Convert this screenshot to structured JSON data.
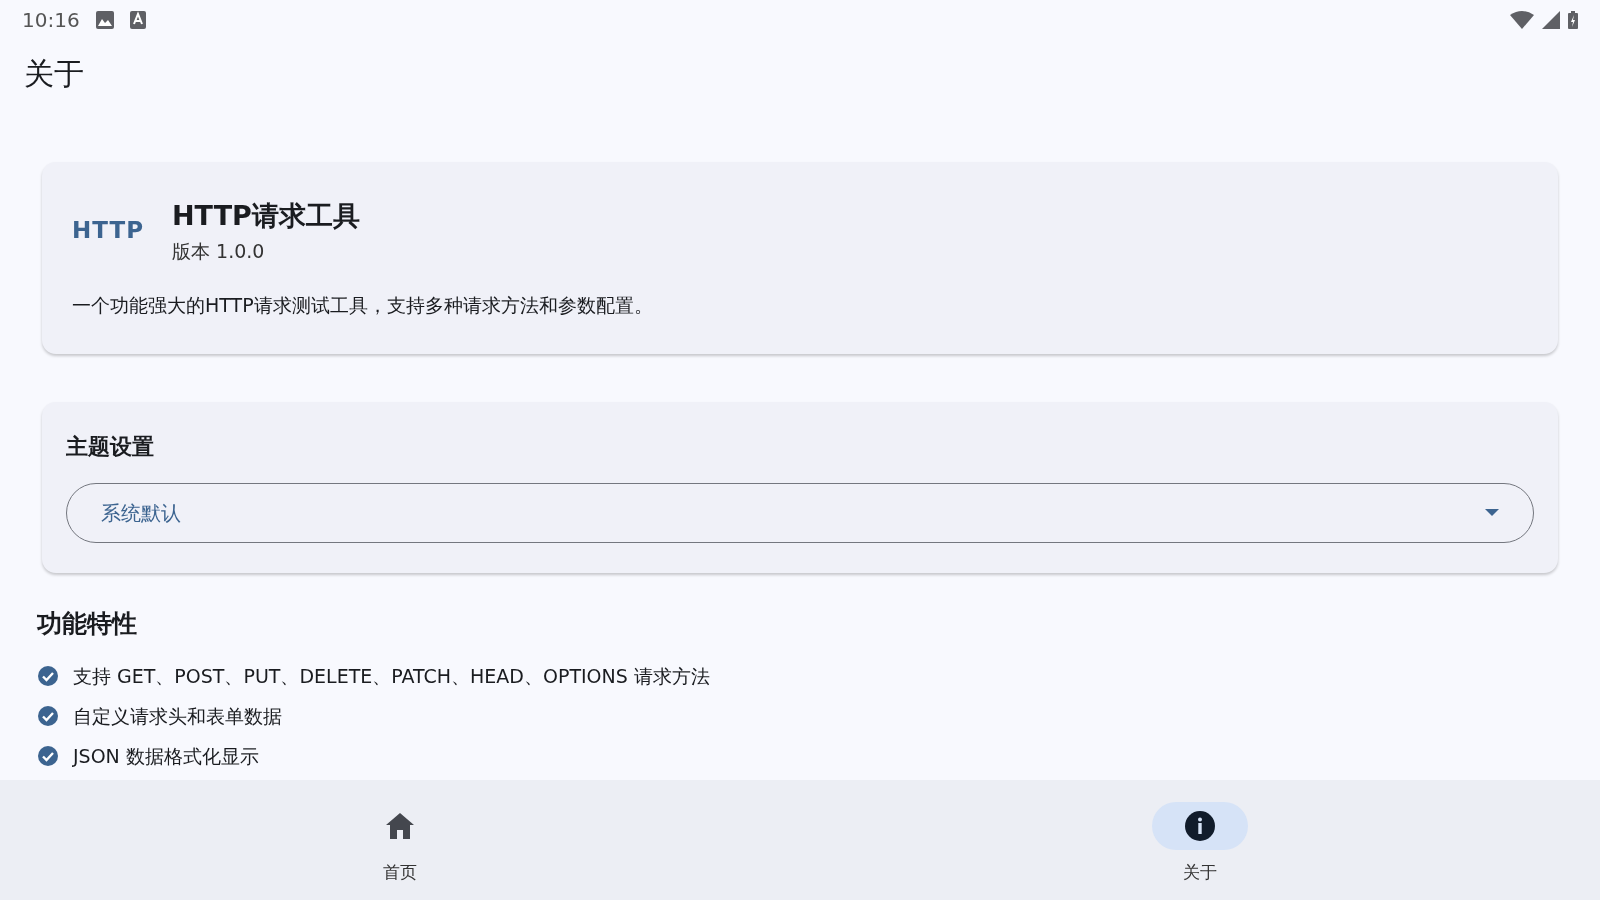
{
  "status_bar": {
    "time": "10:16"
  },
  "app_bar": {
    "title": "关于"
  },
  "app_card": {
    "logo": "HTTP",
    "name": "HTTP请求工具",
    "version": "版本 1.0.0",
    "description": "一个功能强大的HTTP请求测试工具，支持多种请求方法和参数配置。"
  },
  "theme_settings": {
    "title": "主题设置",
    "dropdown": {
      "value": "系统默认"
    }
  },
  "features": {
    "title": "功能特性",
    "items": [
      {
        "text": "支持 GET、POST、PUT、DELETE、PATCH、HEAD、OPTIONS 请求方法",
        "checked": true
      },
      {
        "text": "自定义请求头和表单数据",
        "checked": true
      },
      {
        "text": "JSON 数据格式化显示",
        "checked": true
      }
    ]
  },
  "bottom_nav": [
    {
      "kind": "home",
      "label": "首页",
      "selected": false
    },
    {
      "kind": "info",
      "label": "关于",
      "selected": true
    }
  ]
}
